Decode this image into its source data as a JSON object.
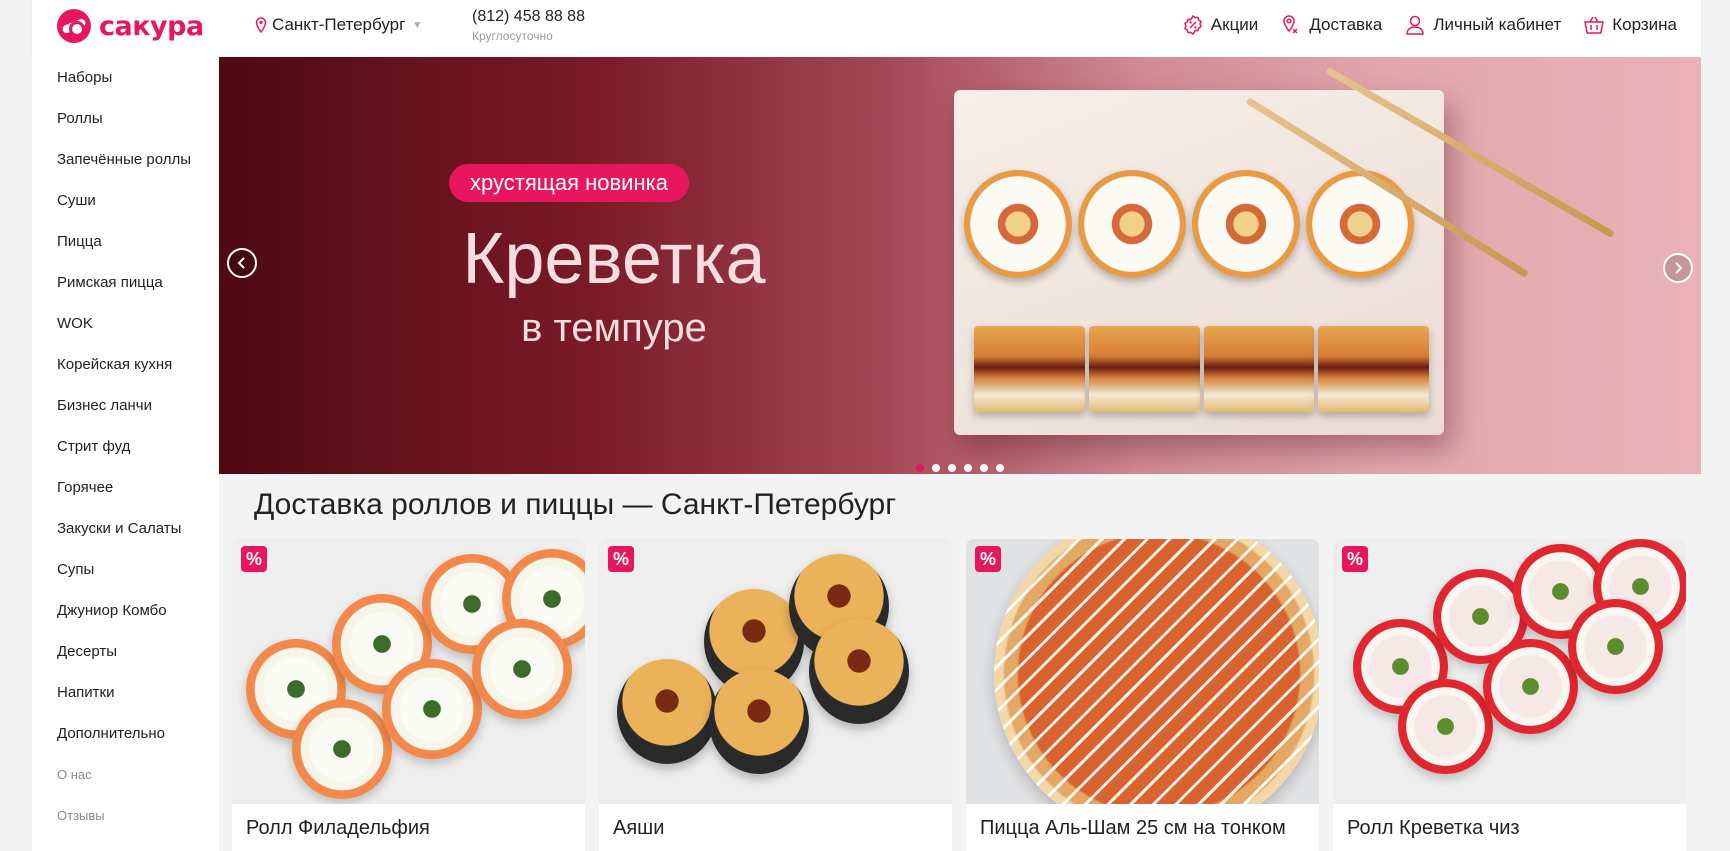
{
  "header": {
    "logo_text": "сакура",
    "city": "Санкт-Петербург",
    "phone": "(812) 458 88 88",
    "hours": "Круглосуточно",
    "nav": [
      {
        "label": "Акции",
        "icon": "percent-icon"
      },
      {
        "label": "Доставка",
        "icon": "delivery-pin-icon"
      },
      {
        "label": "Личный кабинет",
        "icon": "user-icon"
      },
      {
        "label": "Корзина",
        "icon": "basket-icon"
      }
    ]
  },
  "sidebar": {
    "items": [
      "Наборы",
      "Роллы",
      "Запечённые роллы",
      "Суши",
      "Пицца",
      "Римская пицца",
      "WOK",
      "Корейская кухня",
      "Бизнес ланчи",
      "Стрит фуд",
      "Горячее",
      "Закуски и Салаты",
      "Супы",
      "Джуниор Комбо",
      "Десерты",
      "Напитки",
      "Дополнительно"
    ],
    "secondary": [
      "О нас",
      "Отзывы"
    ]
  },
  "banner": {
    "badge": "хрустящая новинка",
    "title": "Креветка",
    "subtitle": "в темпуре",
    "slides_count": 6,
    "active_slide": 1
  },
  "main": {
    "title": "Доставка роллов и пиццы — Санкт-Петербург",
    "products": [
      {
        "name": "Ролл Филадельфия",
        "badge": "%"
      },
      {
        "name": "Аяши",
        "badge": "%"
      },
      {
        "name": "Пицца Аль-Шам 25 см на тонком",
        "badge": "%"
      },
      {
        "name": "Ролл Креветка чиз",
        "badge": "%"
      }
    ]
  },
  "colors": {
    "brand": "#e8175d",
    "background": "#f3f3f3"
  }
}
